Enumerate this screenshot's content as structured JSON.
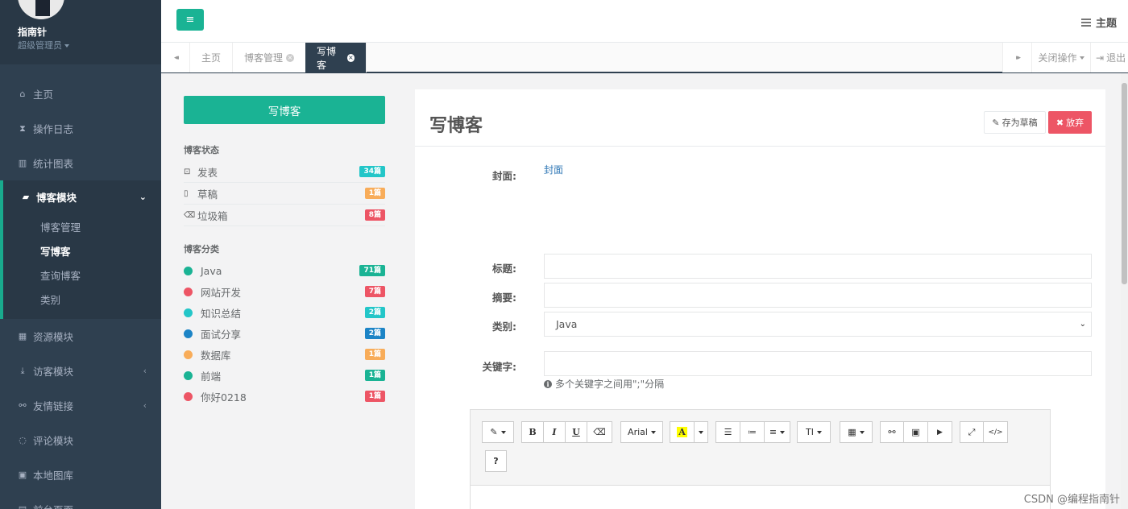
{
  "user": {
    "name": "指南针",
    "role": "超级管理员"
  },
  "sidebar": {
    "items": [
      {
        "label": "主页",
        "icon": "home-icon",
        "glyph": "⌂"
      },
      {
        "label": "操作日志",
        "icon": "hourglass-icon",
        "glyph": "⧗"
      },
      {
        "label": "统计图表",
        "icon": "bar-chart-icon",
        "glyph": "▥"
      },
      {
        "label": "博客模块",
        "icon": "book-icon",
        "glyph": "▰",
        "arrow": "⌄"
      },
      {
        "label": "资源模块",
        "icon": "table-icon",
        "glyph": "▦"
      },
      {
        "label": "访客模块",
        "icon": "download-icon",
        "glyph": "⤓",
        "arrow": "‹"
      },
      {
        "label": "友情链接",
        "icon": "link-icon",
        "glyph": "⚯",
        "arrow": "‹"
      },
      {
        "label": "评论模块",
        "icon": "comment-icon",
        "glyph": "◌"
      },
      {
        "label": "本地图库",
        "icon": "image-icon",
        "glyph": "▣"
      },
      {
        "label": "前台页面",
        "icon": "page-icon",
        "glyph": "▤"
      }
    ],
    "sub_items": [
      "博客管理",
      "写博客",
      "查询博客",
      "类别"
    ]
  },
  "header": {
    "menu_glyph": "≡",
    "theme_label": "主题"
  },
  "tabs": {
    "prev_glyph": "◂◂",
    "next_glyph": "▸▸",
    "items": [
      {
        "label": "主页"
      },
      {
        "label": "博客管理"
      },
      {
        "label": "写博客"
      }
    ],
    "close_ops": "关闭操作",
    "logout": "退出",
    "logout_glyph": "⇥"
  },
  "left_panel": {
    "write_button": "写博客",
    "status_title": "博客状态",
    "statuses": [
      {
        "label": "发表",
        "count": "34篇",
        "color": "#23c6c8",
        "glyph": "⊡"
      },
      {
        "label": "草稿",
        "count": "1篇",
        "color": "#f8ac59",
        "glyph": "▯"
      },
      {
        "label": "垃圾箱",
        "count": "8篇",
        "color": "#ed5565",
        "glyph": "⌫"
      }
    ],
    "category_title": "博客分类",
    "categories": [
      {
        "label": "Java",
        "count": "71篇",
        "color": "#1ab394"
      },
      {
        "label": "网站开发",
        "count": "7篇",
        "color": "#ed5565"
      },
      {
        "label": "知识总结",
        "count": "2篇",
        "color": "#23c6c8"
      },
      {
        "label": "面试分享",
        "count": "2篇",
        "color": "#1c84c6"
      },
      {
        "label": "数据库",
        "count": "1篇",
        "color": "#f8ac59"
      },
      {
        "label": "前端",
        "count": "1篇",
        "color": "#1ab394"
      },
      {
        "label": "你好0218",
        "count": "1篇",
        "color": "#ed5565"
      }
    ]
  },
  "form": {
    "title": "写博客",
    "draft_button": "存为草稿",
    "discard_button": "放弃",
    "cover_label": "封面:",
    "cover_link": "封面",
    "title_label": "标题:",
    "title_value": "",
    "summary_label": "摘要:",
    "summary_value": "",
    "category_label": "类别:",
    "category_value": "Java",
    "keywords_label": "关键字:",
    "keywords_value": "",
    "keywords_hint": "多个关键字之间用\";\"分隔"
  },
  "editor_toolbar": {
    "magic": "✎",
    "bold": "B",
    "italic": "I",
    "underline": "U",
    "eraser": "⌫",
    "font": "Arial",
    "color": "A",
    "ul": "☰",
    "ol": "≔",
    "align": "≡",
    "height": "TI",
    "table": "▦",
    "link": "⚯",
    "picture": "▣",
    "video": "▶",
    "fullscreen": "⤢",
    "code": "</>",
    "help": "?"
  },
  "watermark": "CSDN @编程指南针"
}
